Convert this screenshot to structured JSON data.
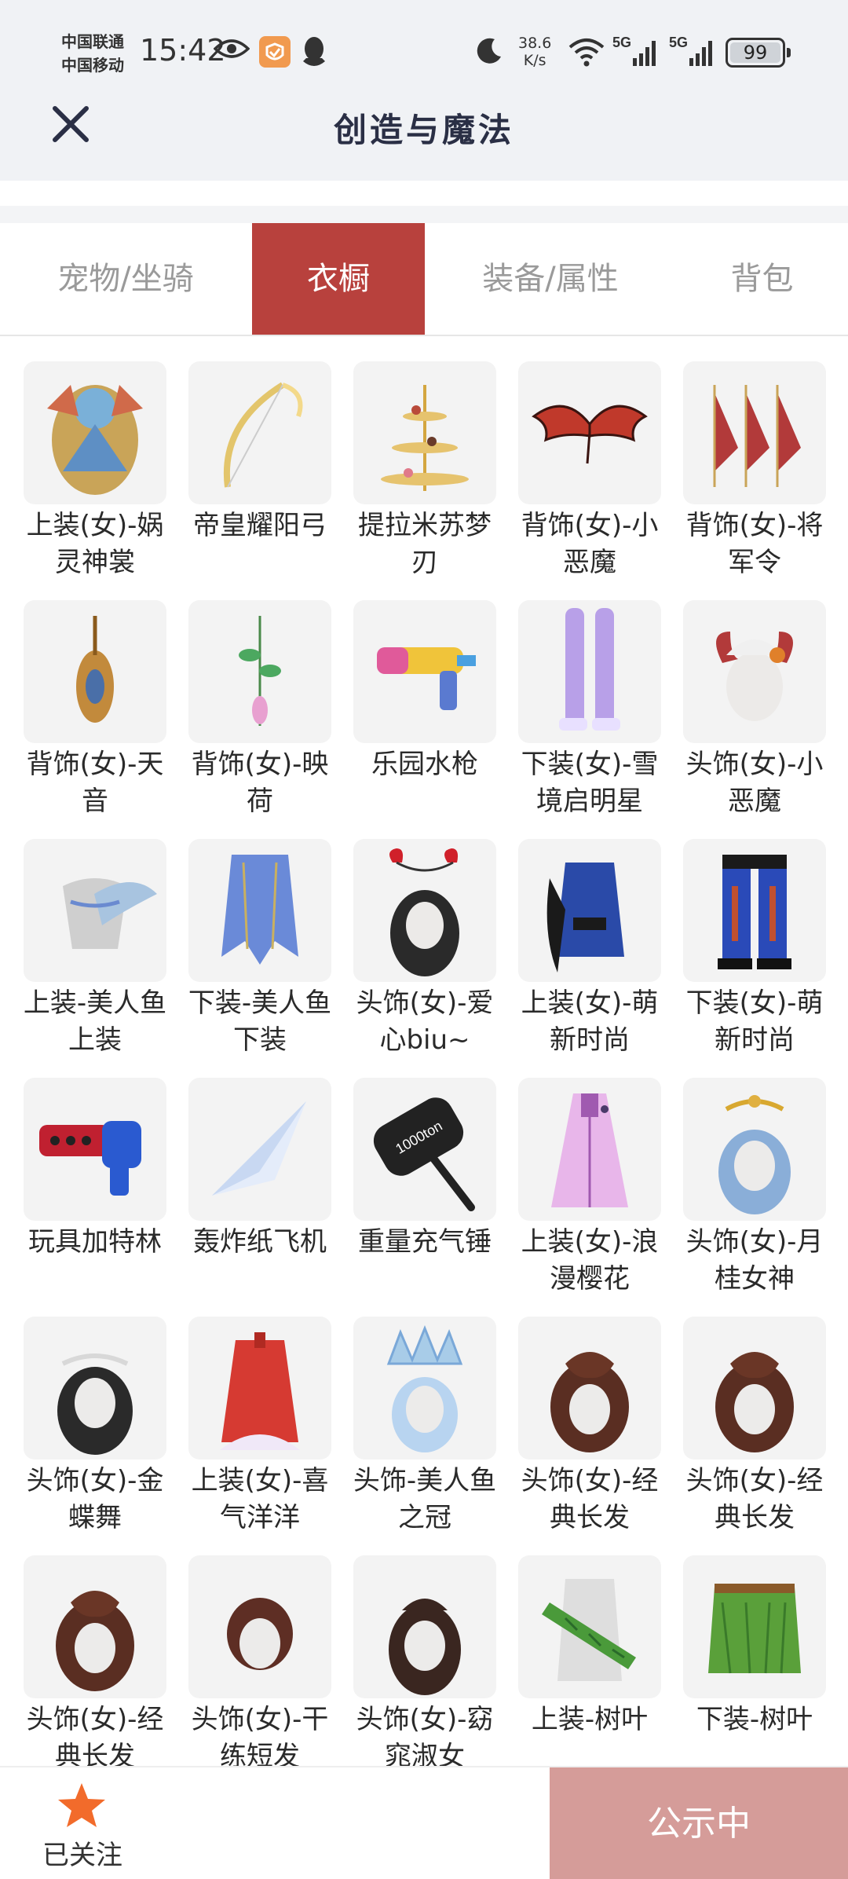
{
  "status_bar": {
    "carrier_1": "中国联通",
    "carrier_2": "中国移动",
    "time": "15:42",
    "speed_value": "38.6",
    "speed_unit": "K/s",
    "network_1": "5G",
    "network_2": "5G",
    "battery": "99"
  },
  "header": {
    "title": "创造与魔法"
  },
  "tabs": [
    {
      "label": "宠物/坐骑",
      "active": false
    },
    {
      "label": "衣橱",
      "active": true
    },
    {
      "label": "装备/属性",
      "active": false
    },
    {
      "label": "背包",
      "active": false
    }
  ],
  "items": [
    {
      "name": "上装(女)-娲灵神裳",
      "icon": "costume-top-icon"
    },
    {
      "name": "帝皇耀阳弓",
      "icon": "bow-icon"
    },
    {
      "name": "提拉米苏梦刃",
      "icon": "dessert-stand-icon"
    },
    {
      "name": "背饰(女)-小恶魔",
      "icon": "devil-wings-icon"
    },
    {
      "name": "背饰(女)-将军令",
      "icon": "flags-icon"
    },
    {
      "name": "背饰(女)-天音",
      "icon": "lute-icon"
    },
    {
      "name": "背饰(女)-映荷",
      "icon": "lotus-branch-icon"
    },
    {
      "name": "乐园水枪",
      "icon": "water-gun-icon"
    },
    {
      "name": "下装(女)-雪境启明星",
      "icon": "stockings-icon"
    },
    {
      "name": "头饰(女)-小恶魔",
      "icon": "devil-head-icon"
    },
    {
      "name": "上装-美人鱼上装",
      "icon": "mermaid-top-icon"
    },
    {
      "name": "下装-美人鱼下装",
      "icon": "mermaid-tail-icon"
    },
    {
      "name": "头饰(女)-爱心biu~",
      "icon": "heart-headband-icon"
    },
    {
      "name": "上装(女)-萌新时尚",
      "icon": "fashion-top-icon"
    },
    {
      "name": "下装(女)-萌新时尚",
      "icon": "fashion-pants-icon"
    },
    {
      "name": "玩具加特林",
      "icon": "gatling-gun-icon"
    },
    {
      "name": "轰炸纸飞机",
      "icon": "paper-plane-icon"
    },
    {
      "name": "重量充气锤",
      "icon": "hammer-icon",
      "hammer_text": "1000ton"
    },
    {
      "name": "上装(女)-浪漫樱花",
      "icon": "sakura-dress-icon"
    },
    {
      "name": "头饰(女)-月桂女神",
      "icon": "laurel-head-icon"
    },
    {
      "name": "头饰(女)-金蝶舞",
      "icon": "butterfly-head-icon"
    },
    {
      "name": "上装(女)-喜气洋洋",
      "icon": "festive-top-icon"
    },
    {
      "name": "头饰-美人鱼之冠",
      "icon": "mermaid-crown-icon"
    },
    {
      "name": "头饰(女)-经典长发",
      "icon": "long-hair-icon"
    },
    {
      "name": "头饰(女)-经典长发",
      "icon": "long-hair-icon"
    },
    {
      "name": "头饰(女)-经典长发",
      "icon": "long-hair-icon"
    },
    {
      "name": "头饰(女)-干练短发",
      "icon": "short-hair-icon"
    },
    {
      "name": "头饰(女)-窈窕淑女",
      "icon": "lady-hair-icon"
    },
    {
      "name": "上装-树叶",
      "icon": "leaf-top-icon"
    },
    {
      "name": "下装-树叶",
      "icon": "leaf-skirt-icon"
    }
  ],
  "bottom_bar": {
    "follow_label": "已关注",
    "notice_button": "公示中"
  },
  "colors": {
    "active_tab": "#b8413d",
    "notice_button": "#d59c99",
    "star": "#f26b2b",
    "header_bg": "#f0f2f5"
  }
}
